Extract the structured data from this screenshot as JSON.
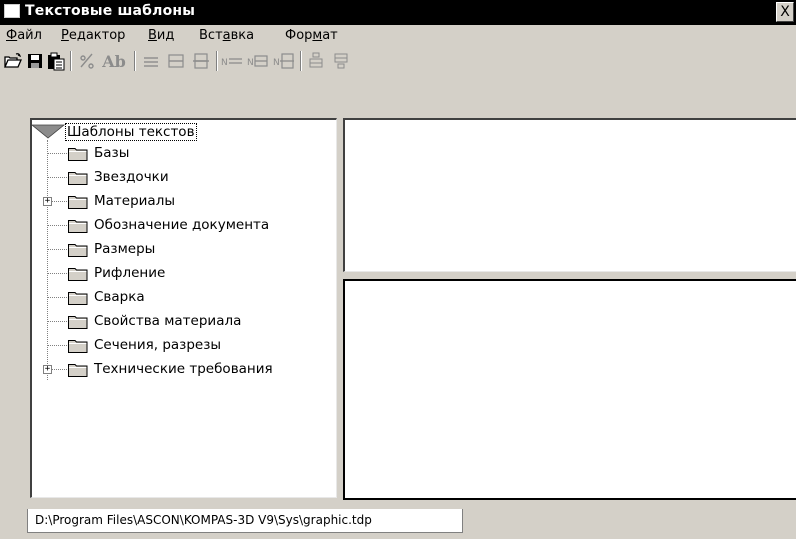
{
  "window": {
    "title": "Текстовые шаблоны",
    "close_label": "X"
  },
  "menu": [
    {
      "pre": "",
      "key": "Ф",
      "post": "айл"
    },
    {
      "pre": "",
      "key": "Р",
      "post": "едактор"
    },
    {
      "pre": "",
      "key": "В",
      "post": "ид"
    },
    {
      "pre": "Вст",
      "key": "а",
      "post": "вка"
    },
    {
      "pre": "Фор",
      "key": "м",
      "post": "ат"
    }
  ],
  "toolbar": {
    "icons": [
      "open-icon",
      "save-icon",
      "paste-icon",
      "insert-special-icon",
      "font-style-icon",
      "align-top-icon",
      "align-middle-icon",
      "align-bottom-icon",
      "numbered-top-icon",
      "numbered-middle-icon",
      "numbered-bottom-icon",
      "move-up-icon",
      "move-down-icon"
    ],
    "font_style_label": "Ab"
  },
  "tree": {
    "root": "Шаблоны текстов",
    "items": [
      {
        "label": "Базы",
        "expandable": false
      },
      {
        "label": "Звездочки",
        "expandable": false
      },
      {
        "label": "Материалы",
        "expandable": true
      },
      {
        "label": "Обозначение документа",
        "expandable": false
      },
      {
        "label": "Размеры",
        "expandable": false
      },
      {
        "label": "Рифление",
        "expandable": false
      },
      {
        "label": "Сварка",
        "expandable": false
      },
      {
        "label": "Свойства материала",
        "expandable": false
      },
      {
        "label": "Сечения, разрезы",
        "expandable": false
      },
      {
        "label": "Технические требования",
        "expandable": true
      }
    ]
  },
  "status": {
    "file_path": "D:\\Program Files\\ASCON\\KOMPAS-3D V9\\Sys\\graphic.tdp"
  }
}
